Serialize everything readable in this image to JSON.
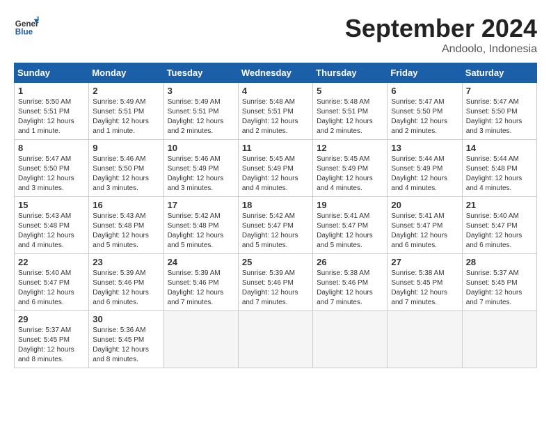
{
  "logo": {
    "text_general": "General",
    "text_blue": "Blue"
  },
  "header": {
    "month": "September 2024",
    "location": "Andoolo, Indonesia"
  },
  "weekdays": [
    "Sunday",
    "Monday",
    "Tuesday",
    "Wednesday",
    "Thursday",
    "Friday",
    "Saturday"
  ],
  "weeks": [
    [
      {
        "day": "1",
        "info": "Sunrise: 5:50 AM\nSunset: 5:51 PM\nDaylight: 12 hours\nand 1 minute."
      },
      {
        "day": "2",
        "info": "Sunrise: 5:49 AM\nSunset: 5:51 PM\nDaylight: 12 hours\nand 1 minute."
      },
      {
        "day": "3",
        "info": "Sunrise: 5:49 AM\nSunset: 5:51 PM\nDaylight: 12 hours\nand 2 minutes."
      },
      {
        "day": "4",
        "info": "Sunrise: 5:48 AM\nSunset: 5:51 PM\nDaylight: 12 hours\nand 2 minutes."
      },
      {
        "day": "5",
        "info": "Sunrise: 5:48 AM\nSunset: 5:51 PM\nDaylight: 12 hours\nand 2 minutes."
      },
      {
        "day": "6",
        "info": "Sunrise: 5:47 AM\nSunset: 5:50 PM\nDaylight: 12 hours\nand 2 minutes."
      },
      {
        "day": "7",
        "info": "Sunrise: 5:47 AM\nSunset: 5:50 PM\nDaylight: 12 hours\nand 3 minutes."
      }
    ],
    [
      {
        "day": "8",
        "info": "Sunrise: 5:47 AM\nSunset: 5:50 PM\nDaylight: 12 hours\nand 3 minutes."
      },
      {
        "day": "9",
        "info": "Sunrise: 5:46 AM\nSunset: 5:50 PM\nDaylight: 12 hours\nand 3 minutes."
      },
      {
        "day": "10",
        "info": "Sunrise: 5:46 AM\nSunset: 5:49 PM\nDaylight: 12 hours\nand 3 minutes."
      },
      {
        "day": "11",
        "info": "Sunrise: 5:45 AM\nSunset: 5:49 PM\nDaylight: 12 hours\nand 4 minutes."
      },
      {
        "day": "12",
        "info": "Sunrise: 5:45 AM\nSunset: 5:49 PM\nDaylight: 12 hours\nand 4 minutes."
      },
      {
        "day": "13",
        "info": "Sunrise: 5:44 AM\nSunset: 5:49 PM\nDaylight: 12 hours\nand 4 minutes."
      },
      {
        "day": "14",
        "info": "Sunrise: 5:44 AM\nSunset: 5:48 PM\nDaylight: 12 hours\nand 4 minutes."
      }
    ],
    [
      {
        "day": "15",
        "info": "Sunrise: 5:43 AM\nSunset: 5:48 PM\nDaylight: 12 hours\nand 4 minutes."
      },
      {
        "day": "16",
        "info": "Sunrise: 5:43 AM\nSunset: 5:48 PM\nDaylight: 12 hours\nand 5 minutes."
      },
      {
        "day": "17",
        "info": "Sunrise: 5:42 AM\nSunset: 5:48 PM\nDaylight: 12 hours\nand 5 minutes."
      },
      {
        "day": "18",
        "info": "Sunrise: 5:42 AM\nSunset: 5:47 PM\nDaylight: 12 hours\nand 5 minutes."
      },
      {
        "day": "19",
        "info": "Sunrise: 5:41 AM\nSunset: 5:47 PM\nDaylight: 12 hours\nand 5 minutes."
      },
      {
        "day": "20",
        "info": "Sunrise: 5:41 AM\nSunset: 5:47 PM\nDaylight: 12 hours\nand 6 minutes."
      },
      {
        "day": "21",
        "info": "Sunrise: 5:40 AM\nSunset: 5:47 PM\nDaylight: 12 hours\nand 6 minutes."
      }
    ],
    [
      {
        "day": "22",
        "info": "Sunrise: 5:40 AM\nSunset: 5:47 PM\nDaylight: 12 hours\nand 6 minutes."
      },
      {
        "day": "23",
        "info": "Sunrise: 5:39 AM\nSunset: 5:46 PM\nDaylight: 12 hours\nand 6 minutes."
      },
      {
        "day": "24",
        "info": "Sunrise: 5:39 AM\nSunset: 5:46 PM\nDaylight: 12 hours\nand 7 minutes."
      },
      {
        "day": "25",
        "info": "Sunrise: 5:39 AM\nSunset: 5:46 PM\nDaylight: 12 hours\nand 7 minutes."
      },
      {
        "day": "26",
        "info": "Sunrise: 5:38 AM\nSunset: 5:46 PM\nDaylight: 12 hours\nand 7 minutes."
      },
      {
        "day": "27",
        "info": "Sunrise: 5:38 AM\nSunset: 5:45 PM\nDaylight: 12 hours\nand 7 minutes."
      },
      {
        "day": "28",
        "info": "Sunrise: 5:37 AM\nSunset: 5:45 PM\nDaylight: 12 hours\nand 7 minutes."
      }
    ],
    [
      {
        "day": "29",
        "info": "Sunrise: 5:37 AM\nSunset: 5:45 PM\nDaylight: 12 hours\nand 8 minutes."
      },
      {
        "day": "30",
        "info": "Sunrise: 5:36 AM\nSunset: 5:45 PM\nDaylight: 12 hours\nand 8 minutes."
      },
      {
        "day": "",
        "info": ""
      },
      {
        "day": "",
        "info": ""
      },
      {
        "day": "",
        "info": ""
      },
      {
        "day": "",
        "info": ""
      },
      {
        "day": "",
        "info": ""
      }
    ]
  ]
}
